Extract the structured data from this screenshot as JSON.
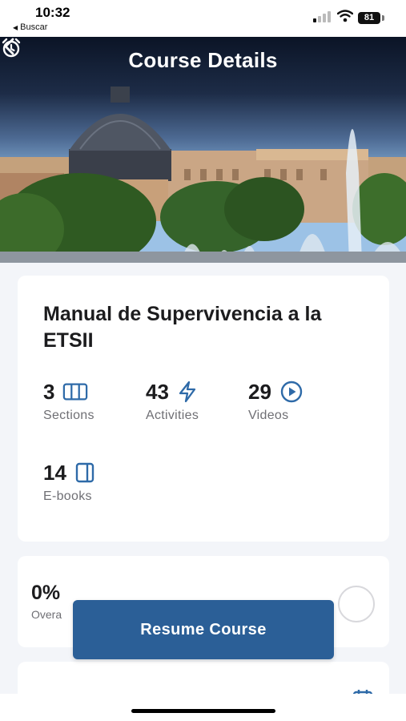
{
  "status_bar": {
    "time": "10:32",
    "back_app_label": "Buscar",
    "battery": "81"
  },
  "header": {
    "title": "Course Details",
    "back_icon": "chevron-left-icon",
    "alarm_icon": "alarm-clock-icon"
  },
  "course": {
    "title": "Manual de Supervivencia a la ETSII",
    "stats": [
      {
        "value": "3",
        "label": "Sections",
        "icon": "columns-icon"
      },
      {
        "value": "43",
        "label": "Activities",
        "icon": "lightning-icon"
      },
      {
        "value": "29",
        "label": "Videos",
        "icon": "play-circle-icon"
      },
      {
        "value": "14",
        "label": "E-books",
        "icon": "book-icon"
      }
    ]
  },
  "progress": {
    "value": "0%",
    "label": "Overall Progress",
    "visible_label": "Overa",
    "fraction": 0
  },
  "resume_button": {
    "label": "Resume Course"
  },
  "colors": {
    "accent": "#2b5f97",
    "icon": "#2e6aa8",
    "background": "#f3f5f9",
    "card": "#ffffff"
  }
}
